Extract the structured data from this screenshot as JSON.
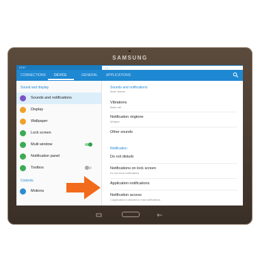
{
  "device": {
    "brand": "SAMSUNG"
  },
  "status": {
    "carrier": "AT&T",
    "right": "▾ ◢ ▮ 12:45 PM"
  },
  "tabs": [
    {
      "label": "CONNECTIONS"
    },
    {
      "label": "DEVICE"
    },
    {
      "label": "GENERAL"
    },
    {
      "label": "APPLICATIONS"
    }
  ],
  "left_panel": {
    "section1": "Sound and display",
    "items1": [
      {
        "label": "Sounds and notifications",
        "icon": "speaker-icon",
        "color": "#7b53c6"
      },
      {
        "label": "Display",
        "icon": "display-icon",
        "color": "#f0a12a"
      },
      {
        "label": "Wallpaper",
        "icon": "wallpaper-icon",
        "color": "#f0a12a"
      },
      {
        "label": "Lock screen",
        "icon": "lock-icon",
        "color": "#3dab56"
      },
      {
        "label": "Multi window",
        "icon": "multi-window-icon",
        "color": "#3dab56"
      },
      {
        "label": "Notification panel",
        "icon": "notification-panel-icon",
        "color": "#3dab56"
      },
      {
        "label": "Toolbox",
        "icon": "toolbox-icon",
        "color": "#3dab56"
      }
    ],
    "section2": "Controls",
    "items2": [
      {
        "label": "Motions",
        "icon": "motions-icon",
        "color": "#2d8bd3"
      }
    ]
  },
  "right_panel": {
    "header": "Sounds and notifications",
    "mode": "Mode: Normal",
    "items": [
      {
        "title": "Vibrations",
        "sub": "Basic call"
      },
      {
        "title": "Notification ringtone",
        "sub": "Whisper"
      },
      {
        "title": "Other sounds",
        "sub": ""
      }
    ],
    "section2": "Notification",
    "items2": [
      {
        "title": "Do not disturb",
        "sub": ""
      },
      {
        "title": "Notifications on lock screen",
        "sub": "Do not show notifications"
      },
      {
        "title": "Application notifications",
        "sub": ""
      },
      {
        "title": "Notification access",
        "sub": "1 application is allowed to read notifications."
      }
    ]
  },
  "colors": {
    "accent": "#1e88d2",
    "arrow": "#f26a1b"
  }
}
